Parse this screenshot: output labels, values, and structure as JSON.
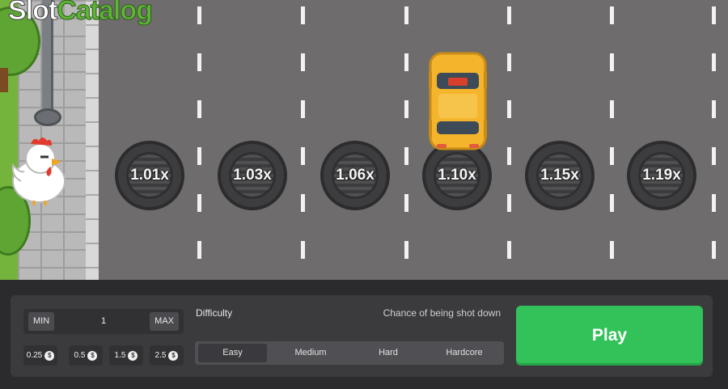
{
  "logo": {
    "part1": "Slot",
    "part2": "Catalog"
  },
  "road": {
    "multipliers": [
      "1.01x",
      "1.03x",
      "1.06x",
      "1.10x",
      "1.15x",
      "1.19x"
    ]
  },
  "controls": {
    "bet": {
      "min_label": "MIN",
      "value": "1",
      "max_label": "MAX"
    },
    "chips": [
      "0.25",
      "0.5",
      "1.5",
      "2.5"
    ],
    "coin_symbol": "$",
    "difficulty_label": "Difficulty",
    "chance_label": "Chance of being shot down",
    "difficulties": [
      "Easy",
      "Medium",
      "Hard",
      "Hardcore"
    ],
    "selected_difficulty": "Easy",
    "play_label": "Play"
  },
  "colors": {
    "road": "#6e6c6d",
    "grass": "#74b43d",
    "panel": "#3b3b3e",
    "play_button": "#33c159",
    "taxi": "#f4b52c",
    "logo_accent": "#5eb537"
  }
}
